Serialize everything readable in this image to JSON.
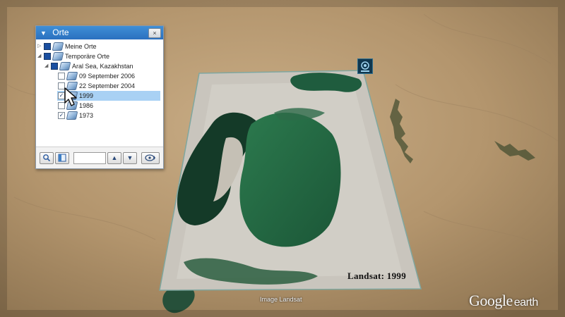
{
  "panel": {
    "title": "Orte",
    "close_label": "×",
    "tree": [
      {
        "label": "Meine Orte",
        "checked": "partial",
        "expander": "▷"
      },
      {
        "label": "Temporäre Orte",
        "checked": "partial",
        "expander": "◢"
      },
      {
        "label": "Aral Sea, Kazakhstan",
        "checked": "partial",
        "expander": "◢"
      },
      {
        "label": "09 September 2006",
        "checked": false
      },
      {
        "label": "22 September 2004",
        "checked": false
      },
      {
        "label": "1999",
        "checked": true,
        "selected": true
      },
      {
        "label": "1986",
        "checked": false
      },
      {
        "label": "1973",
        "checked": true
      }
    ],
    "footer": {
      "search_icon": "magnifier-icon",
      "panel_icon": "sidebar-icon",
      "up_label": "▲",
      "down_label": "▼",
      "tour_icon": "tour-icon"
    }
  },
  "map": {
    "overlay_label": "Landsat:  1999",
    "credit": "Image Landsat",
    "logo_main": "Google",
    "logo_sub": "earth",
    "badge_icon": "overlay-logo-icon"
  },
  "colors": {
    "desert": "#b79a72",
    "water": "#1f5a3a",
    "panel_header": "#2f7cc8",
    "selection": "#a9d1f4"
  }
}
